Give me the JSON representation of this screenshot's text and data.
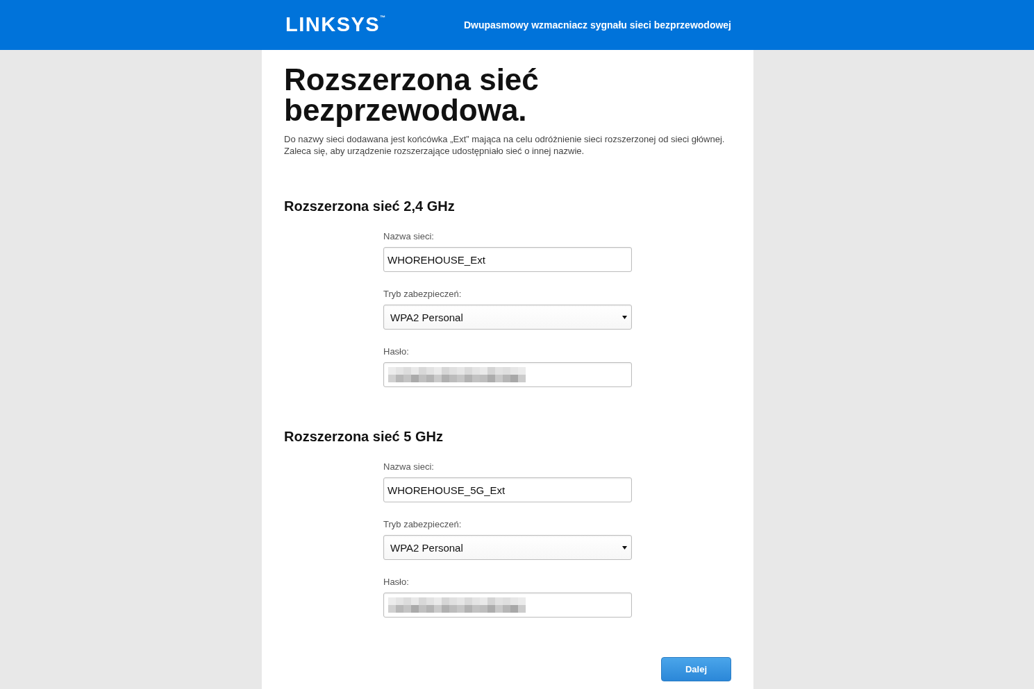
{
  "header": {
    "logo": {
      "text": "LINKSYS",
      "mark": "™"
    },
    "subtitle": "Dwupasmowy wzmacniacz sygnału sieci bezprzewodowej"
  },
  "page": {
    "title": "Rozszerzona sieć bezprzewodowa.",
    "description": "Do nazwy sieci dodawana jest końcówka „Ext” mająca na celu odróżnienie sieci rozszerzonej od sieci głównej. Zaleca się, aby urządzenie rozszerzające udostępniało sieć o innej nazwie."
  },
  "sections": [
    {
      "title": "Rozszerzona sieć 2,4 GHz",
      "fields": [
        {
          "kind": "text",
          "label": "Nazwa sieci:",
          "value": "WHOREHOUSE_Ext"
        },
        {
          "kind": "select",
          "label": "Tryb zabezpieczeń:",
          "value": "WPA2 Personal"
        },
        {
          "kind": "password",
          "label": "Hasło:",
          "obscured": true
        }
      ]
    },
    {
      "title": "Rozszerzona sieć 5 GHz",
      "fields": [
        {
          "kind": "text",
          "label": "Nazwa sieci:",
          "value": "WHOREHOUSE_5G_Ext"
        },
        {
          "kind": "select",
          "label": "Tryb zabezpieczeń:",
          "value": "WPA2 Personal"
        },
        {
          "kind": "password",
          "label": "Hasło:",
          "obscured": true
        }
      ]
    }
  ],
  "buttons": [
    {
      "label": "Dalej"
    }
  ]
}
